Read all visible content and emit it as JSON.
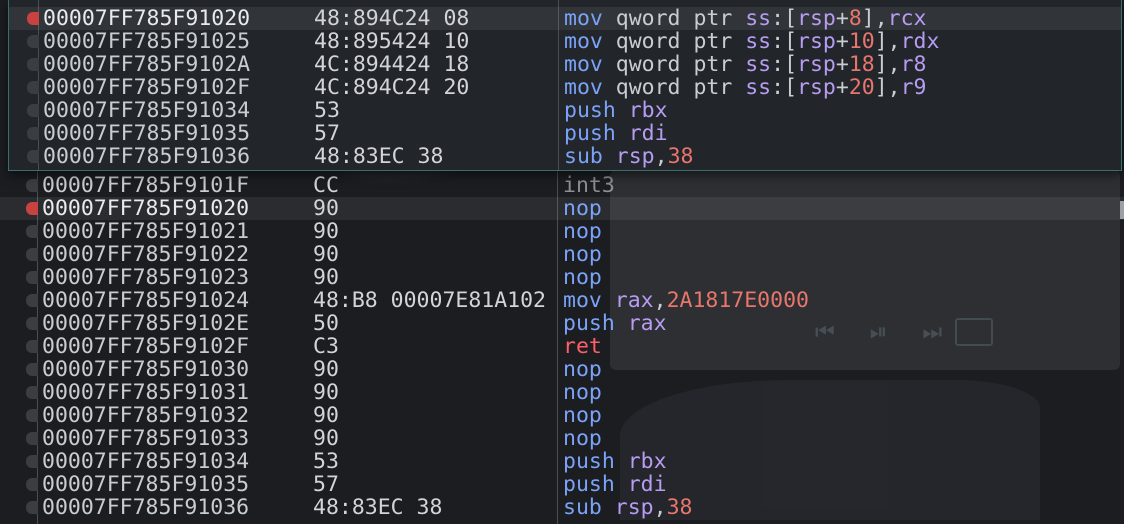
{
  "colors": {
    "background": "#1b1d21",
    "preview_border": "#3d6e6d",
    "mnemonic": "#7aa2f7",
    "register": "#b79cf2",
    "number": "#e8766d",
    "ret": "#ff5f67",
    "breakpoint": "#c8423f"
  },
  "preview": {
    "rows": [
      {
        "addr": "00007FF785F91020",
        "bytes": "48:894C24 08",
        "instr": [
          [
            "m",
            "mov "
          ],
          [
            "p",
            "qword ptr "
          ],
          [
            "r",
            "ss"
          ],
          [
            "p",
            ":["
          ],
          [
            "r",
            "rsp"
          ],
          [
            "p",
            "+"
          ],
          [
            "n",
            "8"
          ],
          [
            "p",
            "],"
          ],
          [
            "r",
            "rcx"
          ]
        ],
        "bp": "active",
        "highlight": true
      },
      {
        "addr": "00007FF785F91025",
        "bytes": "48:895424 10",
        "instr": [
          [
            "m",
            "mov "
          ],
          [
            "p",
            "qword ptr "
          ],
          [
            "r",
            "ss"
          ],
          [
            "p",
            ":["
          ],
          [
            "r",
            "rsp"
          ],
          [
            "p",
            "+"
          ],
          [
            "n",
            "10"
          ],
          [
            "p",
            "],"
          ],
          [
            "r",
            "rdx"
          ]
        ]
      },
      {
        "addr": "00007FF785F9102A",
        "bytes": "4C:894424 18",
        "instr": [
          [
            "m",
            "mov "
          ],
          [
            "p",
            "qword ptr "
          ],
          [
            "r",
            "ss"
          ],
          [
            "p",
            ":["
          ],
          [
            "r",
            "rsp"
          ],
          [
            "p",
            "+"
          ],
          [
            "n",
            "18"
          ],
          [
            "p",
            "],"
          ],
          [
            "r",
            "r8"
          ]
        ]
      },
      {
        "addr": "00007FF785F9102F",
        "bytes": "4C:894C24 20",
        "instr": [
          [
            "m",
            "mov "
          ],
          [
            "p",
            "qword ptr "
          ],
          [
            "r",
            "ss"
          ],
          [
            "p",
            ":["
          ],
          [
            "r",
            "rsp"
          ],
          [
            "p",
            "+"
          ],
          [
            "n",
            "20"
          ],
          [
            "p",
            "],"
          ],
          [
            "r",
            "r9"
          ]
        ]
      },
      {
        "addr": "00007FF785F91034",
        "bytes": "53",
        "instr": [
          [
            "m",
            "push "
          ],
          [
            "r",
            "rbx"
          ]
        ]
      },
      {
        "addr": "00007FF785F91035",
        "bytes": "57",
        "instr": [
          [
            "m",
            "push "
          ],
          [
            "r",
            "rdi"
          ]
        ]
      },
      {
        "addr": "00007FF785F91036",
        "bytes": "48:83EC 38",
        "instr": [
          [
            "m",
            "sub "
          ],
          [
            "r",
            "rsp"
          ],
          [
            "p",
            ","
          ],
          [
            "n",
            "38"
          ]
        ]
      }
    ]
  },
  "listing": {
    "rows": [
      {
        "addr": "00007FF785F9101F",
        "bytes": "CC",
        "instr": [
          [
            "i",
            "int3"
          ]
        ]
      },
      {
        "addr": "00007FF785F91020",
        "bytes": "90",
        "instr": [
          [
            "m",
            "nop"
          ]
        ],
        "bp": "active",
        "highlight": true
      },
      {
        "addr": "00007FF785F91021",
        "bytes": "90",
        "instr": [
          [
            "m",
            "nop"
          ]
        ]
      },
      {
        "addr": "00007FF785F91022",
        "bytes": "90",
        "instr": [
          [
            "m",
            "nop"
          ]
        ]
      },
      {
        "addr": "00007FF785F91023",
        "bytes": "90",
        "instr": [
          [
            "m",
            "nop"
          ]
        ]
      },
      {
        "addr": "00007FF785F91024",
        "bytes": "48:B8 00007E81A102",
        "instr": [
          [
            "m",
            "mov "
          ],
          [
            "r",
            "rax"
          ],
          [
            "p",
            ","
          ],
          [
            "n",
            "2A1817E0000"
          ]
        ]
      },
      {
        "addr": "00007FF785F9102E",
        "bytes": "50",
        "instr": [
          [
            "m",
            "push "
          ],
          [
            "r",
            "rax"
          ]
        ]
      },
      {
        "addr": "00007FF785F9102F",
        "bytes": "C3",
        "instr": [
          [
            "t",
            "ret"
          ]
        ]
      },
      {
        "addr": "00007FF785F91030",
        "bytes": "90",
        "instr": [
          [
            "m",
            "nop"
          ]
        ]
      },
      {
        "addr": "00007FF785F91031",
        "bytes": "90",
        "instr": [
          [
            "m",
            "nop"
          ]
        ]
      },
      {
        "addr": "00007FF785F91032",
        "bytes": "90",
        "instr": [
          [
            "m",
            "nop"
          ]
        ]
      },
      {
        "addr": "00007FF785F91033",
        "bytes": "90",
        "instr": [
          [
            "m",
            "nop"
          ]
        ]
      },
      {
        "addr": "00007FF785F91034",
        "bytes": "53",
        "instr": [
          [
            "m",
            "push "
          ],
          [
            "r",
            "rbx"
          ]
        ]
      },
      {
        "addr": "00007FF785F91035",
        "bytes": "57",
        "instr": [
          [
            "m",
            "push "
          ],
          [
            "r",
            "rdi"
          ]
        ]
      },
      {
        "addr": "00007FF785F91036",
        "bytes": "48:83EC 38",
        "instr": [
          [
            "m",
            "sub "
          ],
          [
            "r",
            "rsp"
          ],
          [
            "p",
            ","
          ],
          [
            "n",
            "38"
          ]
        ]
      }
    ]
  }
}
